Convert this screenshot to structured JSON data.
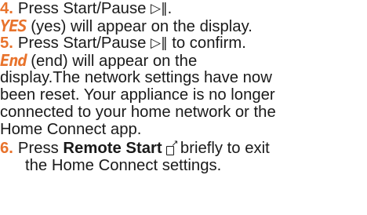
{
  "steps": [
    {
      "number": "4.",
      "text": "Press Start/Pause",
      "icon": "play-pause-icon",
      "suffix": "."
    },
    {
      "display": "YES",
      "text": " (yes) will appear on the display."
    },
    {
      "number": "5.",
      "text": "Press Start/Pause",
      "icon": "play-pause-icon",
      "suffix": " to confirm."
    },
    {
      "display": "End",
      "text": " (end) will appear on the"
    },
    {
      "text": "display.The network settings have now"
    },
    {
      "text": "been reset. Your appliance is no longer"
    },
    {
      "text": "connected to your home network or the"
    },
    {
      "text": "Home Connect app."
    },
    {
      "number": "6.",
      "prefix": "Press ",
      "bold": "Remote Start",
      "icon": "remote-start-icon",
      "suffix": " briefly to exit"
    },
    {
      "text": "the Home Connect settings."
    }
  ],
  "colors": {
    "accent": "#e8732c",
    "text": "#1a1a1a"
  }
}
